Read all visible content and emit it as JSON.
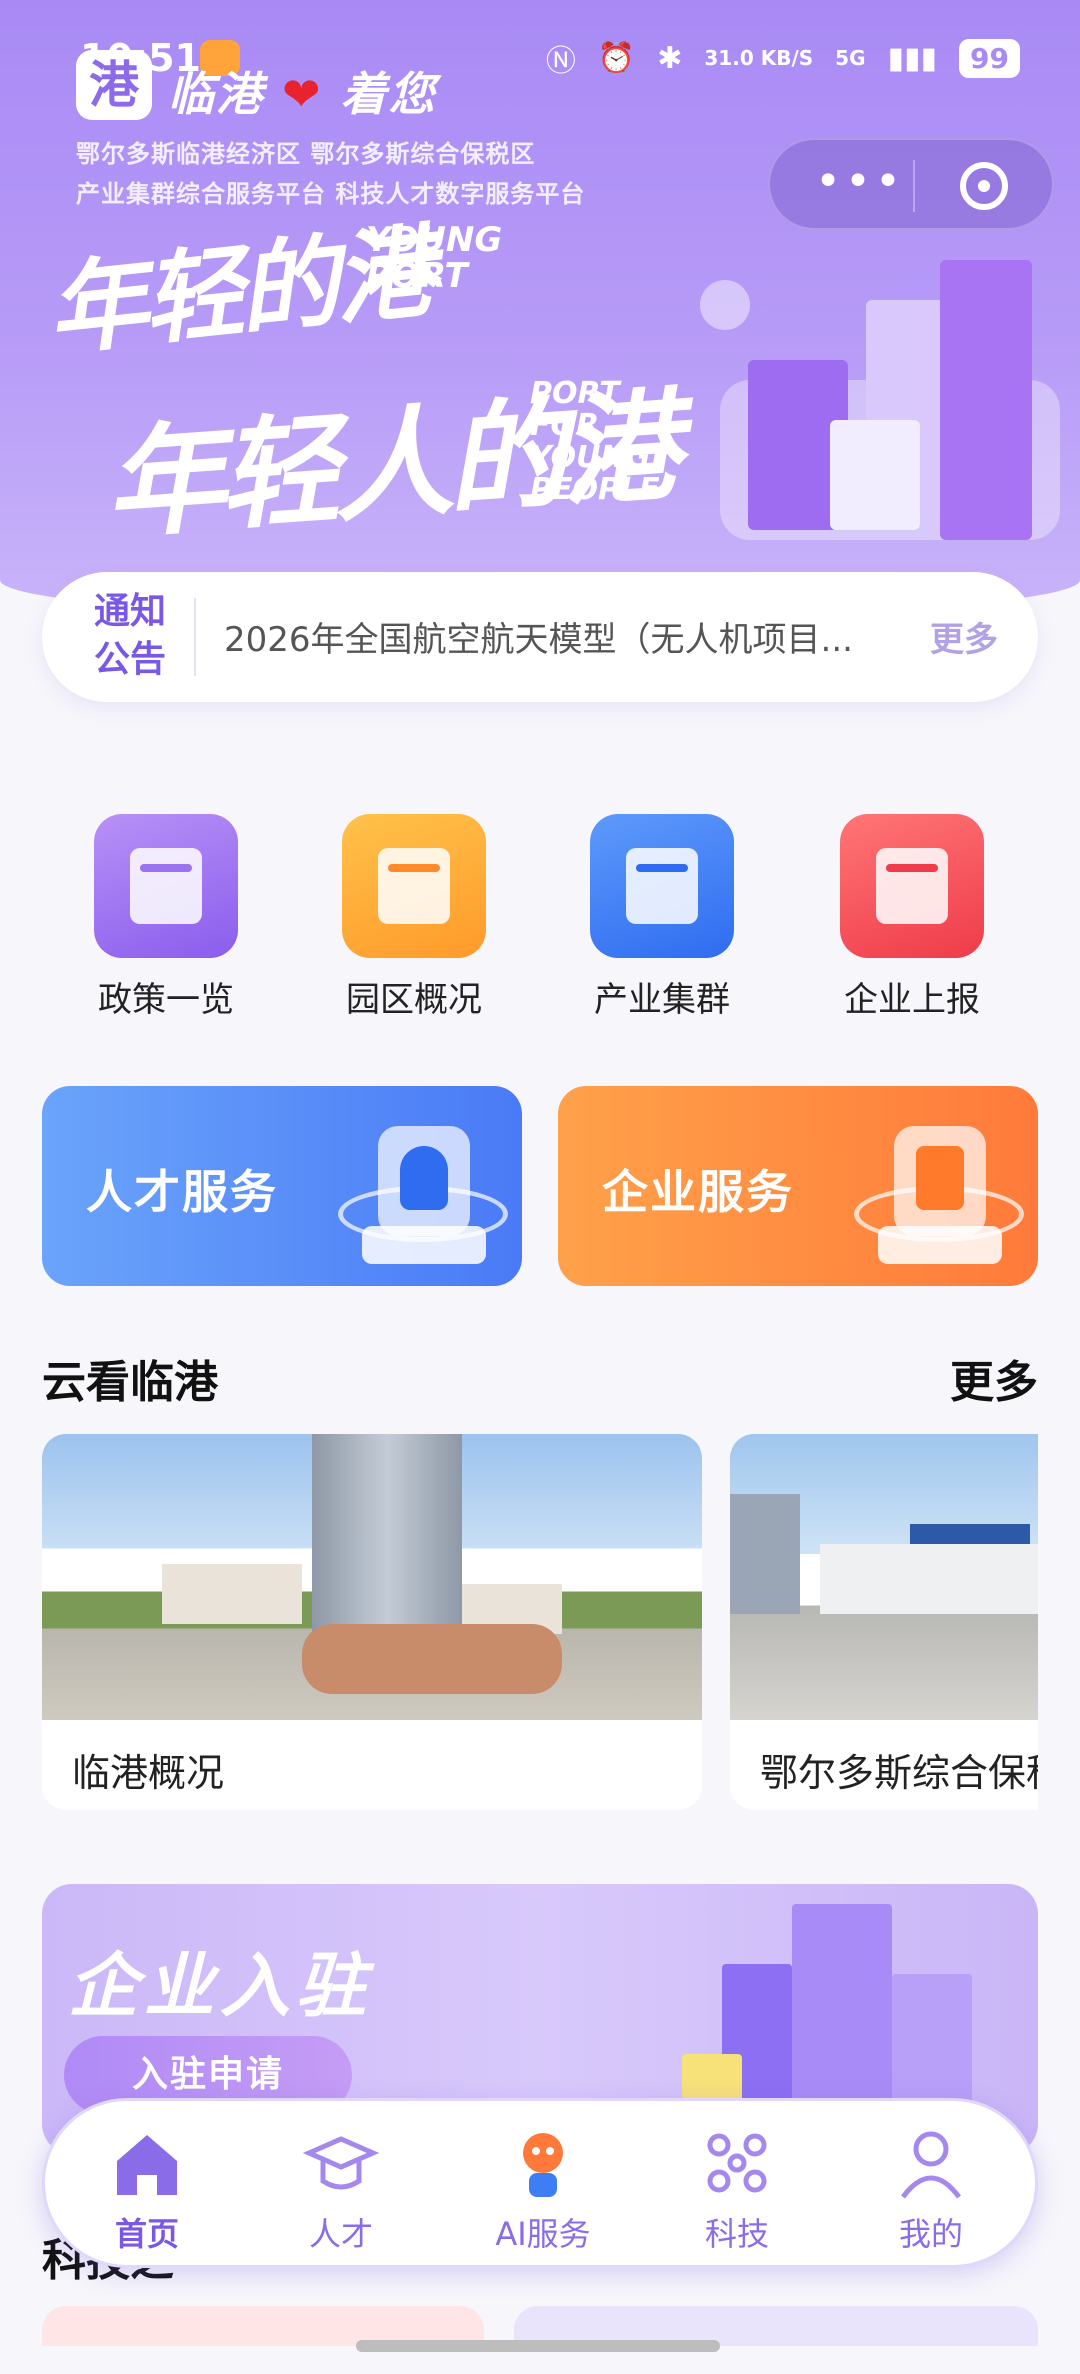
{
  "status_bar": {
    "time": "10:51",
    "net_speed": "31.0 KB/S",
    "signal": "5G",
    "battery": "99"
  },
  "hero": {
    "brand": "临港",
    "brand_suffix": "着您",
    "lines": [
      "鄂尔多斯临港经济区    鄂尔多斯综合保税区",
      "产业集群综合服务平台    科技人才数字服务平台"
    ],
    "slogan1": "年轻的港",
    "slogan1_en": "YOUNG PORT",
    "slogan2": "年轻人的港",
    "slogan2_en": "PORT FOR YOUNG PEOPLE",
    "capsule": {
      "more_icon": "more-dots-icon",
      "close_icon": "target-icon"
    }
  },
  "notice": {
    "label": "通知公告",
    "text": "2026年全国航空航天模型（无人机项目...",
    "more": "更多"
  },
  "quick_links": [
    {
      "label": "政策一览",
      "icon": "policy-icon",
      "color": "#9b72f0"
    },
    {
      "label": "园区概况",
      "icon": "park-icon",
      "color": "#ffa43a"
    },
    {
      "label": "产业集群",
      "icon": "cluster-icon",
      "color": "#3f7df5"
    },
    {
      "label": "企业上报",
      "icon": "report-icon",
      "color": "#f44c5a"
    }
  ],
  "services": [
    {
      "label": "人才服务",
      "color_start": "#6aa4fb",
      "color_end": "#4a7af6"
    },
    {
      "label": "企业服务",
      "color_start": "#ffa14a",
      "color_end": "#ff7a3a"
    }
  ],
  "cloud_view": {
    "title": "云看临港",
    "more": "更多",
    "cards": [
      {
        "caption": "临港概况"
      },
      {
        "caption": "鄂尔多斯综合保税区"
      }
    ]
  },
  "enterprise_banner": {
    "title": "企业入驻",
    "button": "入驻申请"
  },
  "section3": {
    "title": "科技之"
  },
  "tabbar": [
    {
      "label": "首页",
      "icon": "home-icon",
      "active": true
    },
    {
      "label": "人才",
      "icon": "graduation-cap-icon",
      "active": false
    },
    {
      "label": "AI服务",
      "icon": "mascot-icon",
      "active": false
    },
    {
      "label": "科技",
      "icon": "molecule-icon",
      "active": false
    },
    {
      "label": "我的",
      "icon": "user-icon",
      "active": false
    }
  ]
}
